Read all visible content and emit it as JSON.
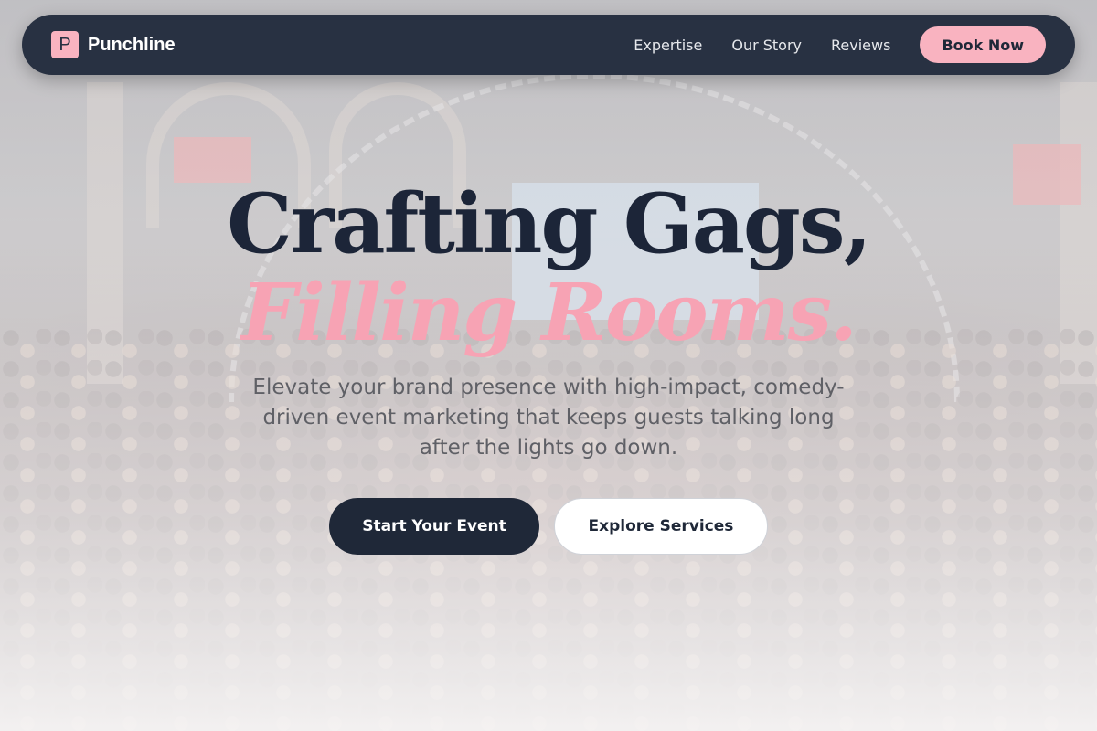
{
  "brand": {
    "logo_letter": "P",
    "name": "Punchline",
    "accent_color": "#f9b3c0",
    "dark_color": "#283142"
  },
  "nav": {
    "links": [
      "Expertise",
      "Our Story",
      "Reviews"
    ],
    "cta_label": "Book Now"
  },
  "hero": {
    "headline_line1": "Crafting Gags,",
    "headline_line2": "Filling Rooms.",
    "subtitle": "Elevate your brand presence with high-impact, comedy-driven event marketing that keeps guests talking long after the lights go down.",
    "primary_button": "Start Your Event",
    "secondary_button": "Explore Services"
  },
  "background": {
    "description_icon": "event-crowd-photo"
  }
}
